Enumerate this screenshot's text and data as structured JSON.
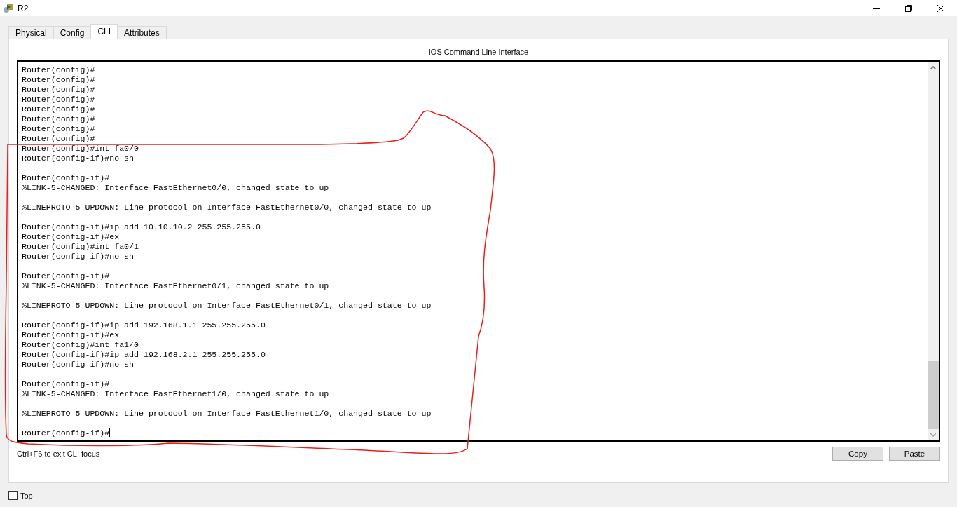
{
  "window": {
    "title": "R2"
  },
  "tabs": [
    {
      "label": "Physical",
      "selected": false
    },
    {
      "label": "Config",
      "selected": false
    },
    {
      "label": "CLI",
      "selected": true
    },
    {
      "label": "Attributes",
      "selected": false
    }
  ],
  "panel": {
    "title": "IOS Command Line Interface",
    "terminal": {
      "blocks": [
        [
          "Router(config)#",
          "Router(config)#",
          "Router(config)#",
          "Router(config)#",
          "Router(config)#",
          "Router(config)#",
          "Router(config)#",
          "Router(config)#",
          "Router(config)#int fa0/0",
          "Router(config-if)#no sh"
        ],
        [
          "Router(config-if)#",
          "%LINK-5-CHANGED: Interface FastEthernet0/0, changed state to up"
        ],
        [
          "%LINEPROTO-5-UPDOWN: Line protocol on Interface FastEthernet0/0, changed state to up"
        ],
        [
          "Router(config-if)#ip add 10.10.10.2 255.255.255.0",
          "Router(config-if)#ex",
          "Router(config)#int fa0/1",
          "Router(config-if)#no sh"
        ],
        [
          "Router(config-if)#",
          "%LINK-5-CHANGED: Interface FastEthernet0/1, changed state to up"
        ],
        [
          "%LINEPROTO-5-UPDOWN: Line protocol on Interface FastEthernet0/1, changed state to up"
        ],
        [
          "Router(config-if)#ip add 192.168.1.1 255.255.255.0",
          "Router(config-if)#ex",
          "Router(config)#int fa1/0",
          "Router(config-if)#ip add 192.168.2.1 255.255.255.0",
          "Router(config-if)#no sh"
        ],
        [
          "Router(config-if)#",
          "%LINK-5-CHANGED: Interface FastEthernet1/0, changed state to up"
        ],
        [
          "%LINEPROTO-5-UPDOWN: Line protocol on Interface FastEthernet1/0, changed state to up"
        ],
        [
          "Router(config-if)#"
        ]
      ],
      "cursor": true
    },
    "hint": "Ctrl+F6 to exit CLI focus",
    "buttons": [
      "Copy",
      "Paste"
    ]
  },
  "top_checkbox": {
    "label": "Top",
    "checked": false
  }
}
